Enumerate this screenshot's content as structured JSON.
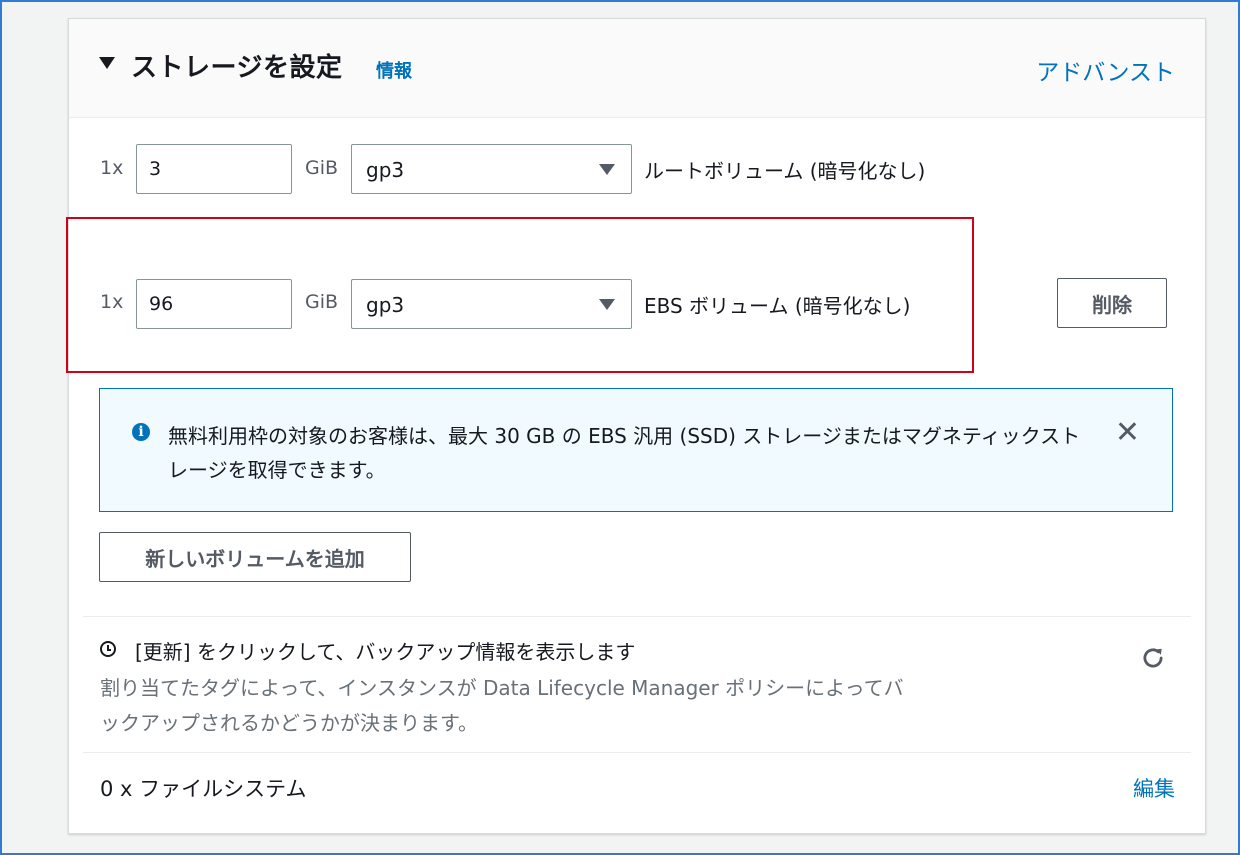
{
  "header": {
    "title": "ストレージを設定",
    "info_link": "情報",
    "advanced_link": "アドバンスト"
  },
  "volumes": [
    {
      "multiplier": "1x",
      "size": "3",
      "unit": "GiB",
      "type": "gp3",
      "description": "ルートボリューム  (暗号化なし)"
    },
    {
      "multiplier": "1x",
      "size": "96",
      "unit": "GiB",
      "type": "gp3",
      "description": "EBS ボリューム  (暗号化なし)",
      "delete_label": "削除"
    }
  ],
  "alert": {
    "icon": "info-icon",
    "text": "無料利用枠の対象のお客様は、最大 30 GB の EBS 汎用 (SSD) ストレージまたはマグネティックストレージを取得できます。",
    "close_symbol": "✕"
  },
  "add_volume_label": "新しいボリュームを追加",
  "backup": {
    "title": "[更新] をクリックして、バックアップ情報を表示します",
    "description": "割り当てたタグによって、インスタンスが Data Lifecycle Manager ポリシーによってバックアップされるかどうかが決まります。"
  },
  "file_systems": {
    "label": "0 x ファイルシステム",
    "edit_label": "編集"
  },
  "colors": {
    "link": "#0073bb",
    "highlight": "#d0021b",
    "alert_bg": "#f1faff"
  }
}
